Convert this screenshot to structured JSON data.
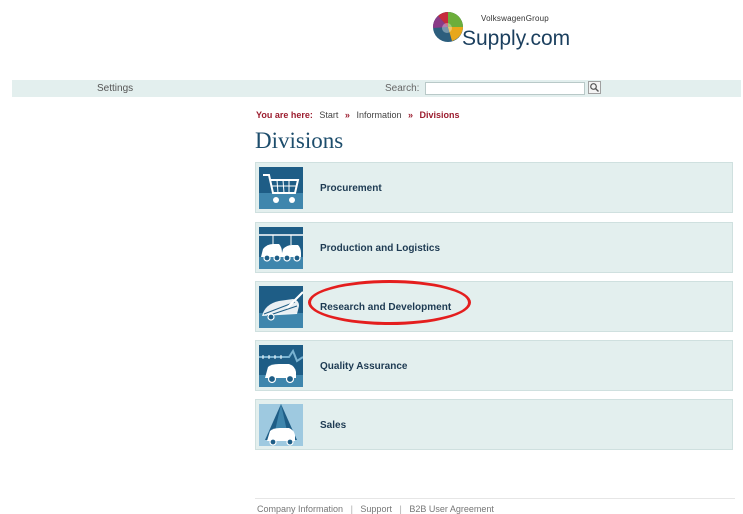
{
  "logo": {
    "brand_small": "VolkswagenGroup",
    "brand_main": "Supply.com"
  },
  "topbar": {
    "settings_label": "Settings",
    "search_label": "Search:",
    "search_value": ""
  },
  "breadcrumb": {
    "prefix": "You are here:",
    "items": [
      "Start",
      "Information",
      "Divisions"
    ],
    "separator": "»"
  },
  "page": {
    "title": "Divisions"
  },
  "divisions": [
    {
      "label": "Procurement",
      "icon": "shopping-cart-icon"
    },
    {
      "label": "Production and Logistics",
      "icon": "cars-conveyor-icon"
    },
    {
      "label": "Research and Development",
      "icon": "car-design-icon"
    },
    {
      "label": "Quality Assurance",
      "icon": "car-measure-icon"
    },
    {
      "label": "Sales",
      "icon": "car-spotlight-icon"
    }
  ],
  "footer": {
    "links": [
      "Company Information",
      "Support",
      "B2B User Agreement"
    ],
    "separator": "|"
  },
  "colors": {
    "accent_red": "#9c1d2f",
    "title_blue": "#1d4d6c",
    "tile_bg": "#e3efee",
    "icon_bg": "#1e5d86",
    "highlight": "#e41e1e"
  }
}
